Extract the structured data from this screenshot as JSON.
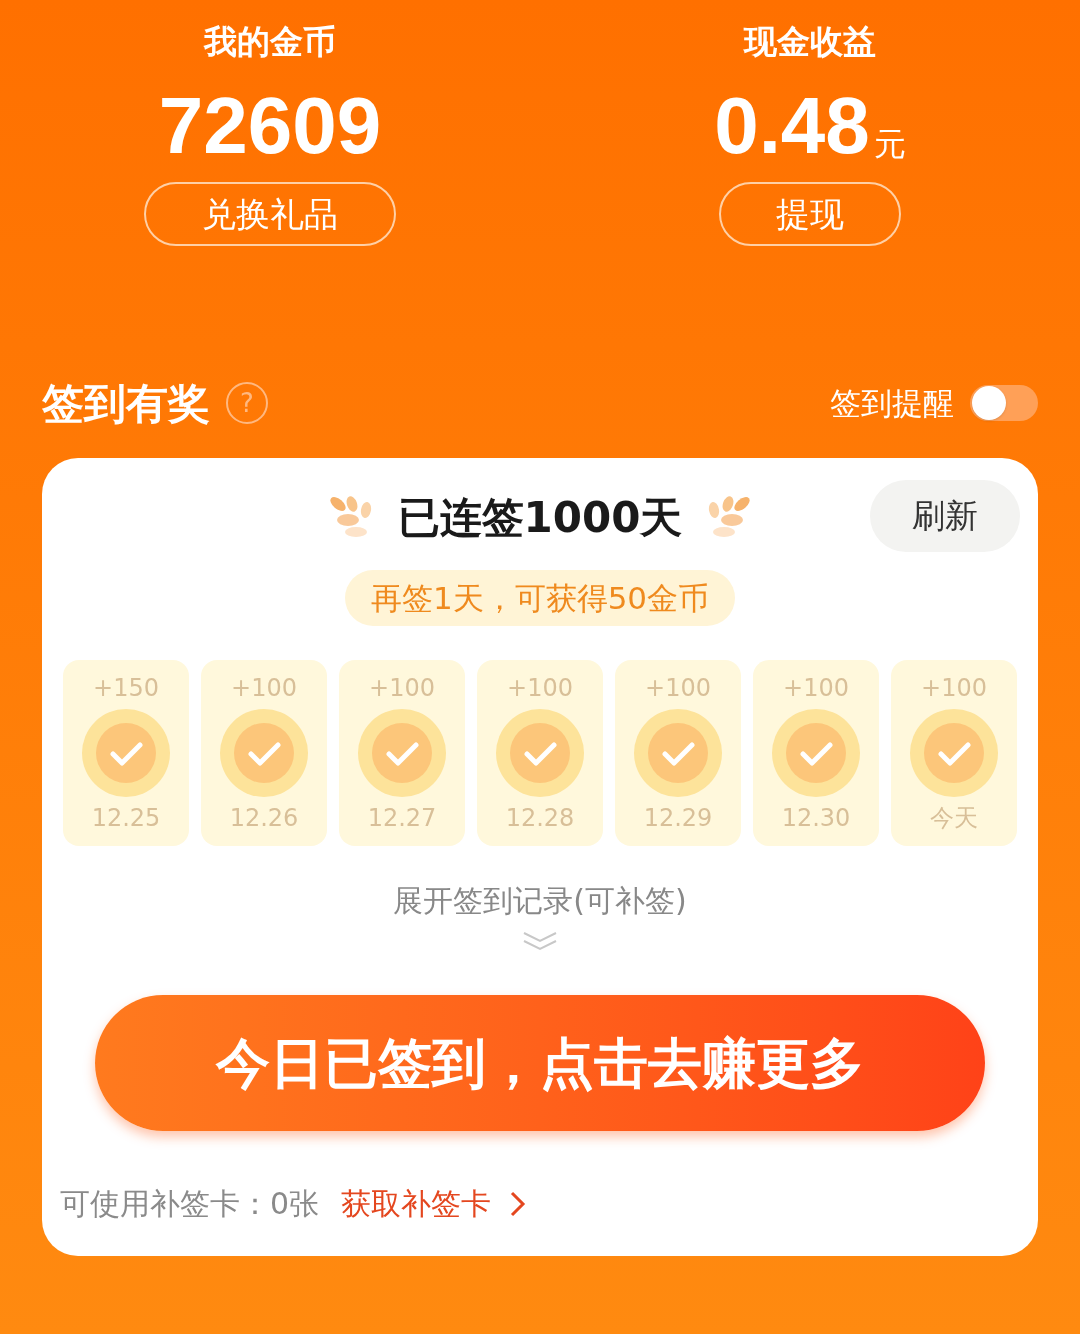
{
  "coins": {
    "title": "我的金币",
    "value": "72609",
    "button": "兑换礼品"
  },
  "cash": {
    "title": "现金收益",
    "value": "0.48",
    "unit": "元",
    "button": "提现"
  },
  "checkin": {
    "title": "签到有奖",
    "help": "?",
    "reminder": {
      "label": "签到提醒",
      "on": false
    }
  },
  "card": {
    "streak": "已连签1000天",
    "refresh": "刷新",
    "hint": "再签1天，可获得50金币",
    "days": [
      {
        "reward": "+150",
        "date": "12.25",
        "checked": true
      },
      {
        "reward": "+100",
        "date": "12.26",
        "checked": true
      },
      {
        "reward": "+100",
        "date": "12.27",
        "checked": true
      },
      {
        "reward": "+100",
        "date": "12.28",
        "checked": true
      },
      {
        "reward": "+100",
        "date": "12.29",
        "checked": true
      },
      {
        "reward": "+100",
        "date": "12.30",
        "checked": true
      },
      {
        "reward": "+100",
        "date": "今天",
        "checked": true
      }
    ],
    "expand": "展开签到记录(可补签)",
    "action": "今日已签到，点击去赚更多",
    "cards_left": "可使用补签卡：0张",
    "get_cards": "获取补签卡"
  }
}
